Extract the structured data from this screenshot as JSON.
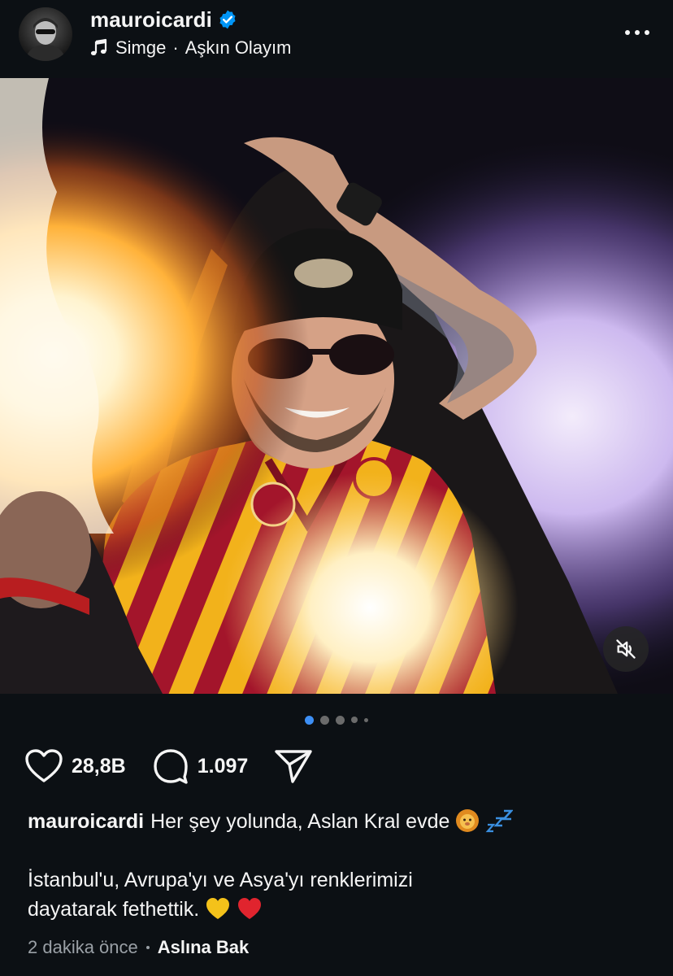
{
  "post": {
    "username": "mauroicardi",
    "verified": true,
    "audio": {
      "artist": "Simge",
      "separator": "·",
      "track": "Aşkın Olayım"
    }
  },
  "media": {
    "muted": true,
    "carousel": {
      "count": 5,
      "active_index": 0
    }
  },
  "actions": {
    "likes": "28,8B",
    "comments": "1.097"
  },
  "caption": {
    "username": "mauroicardi",
    "line1": "Her şey yolunda, Aslan Kral evde",
    "line1_emoji": [
      "lion-face",
      "zzz"
    ],
    "line2": "İstanbul'u, Avrupa'yı ve Asya'yı renklerimizi",
    "line3": "dayatarak fethettik.",
    "line3_emoji": [
      "yellow-heart",
      "red-heart"
    ]
  },
  "meta": {
    "time": "2 dakika önce",
    "translate_label": "Aslına Bak"
  },
  "colors": {
    "background": "#0c1014",
    "text": "#f5f5f5",
    "muted_text": "#9aa0a6",
    "verified_blue": "#0095f6",
    "carousel_active": "#3d8ff5",
    "jersey_red": "#a3152b",
    "jersey_yellow": "#f2b21b"
  },
  "icons": {
    "more": "more-horizontal-icon",
    "music": "music-note-icon",
    "like": "heart-outline-icon",
    "comment": "speech-bubble-icon",
    "share": "paper-plane-icon",
    "mute": "speaker-muted-icon"
  }
}
